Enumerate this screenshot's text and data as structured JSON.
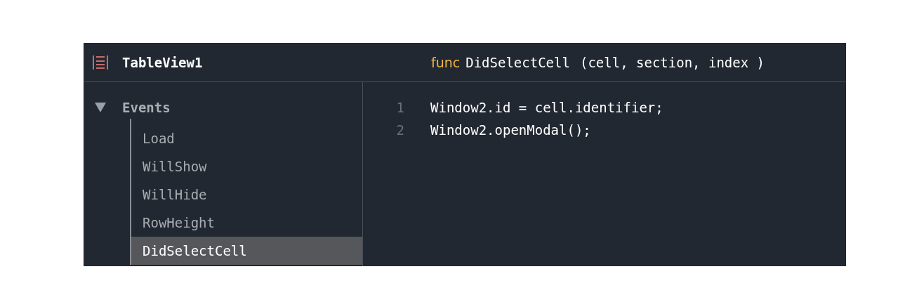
{
  "header": {
    "title": "TableView1",
    "signature": {
      "keyword": "func",
      "name": "DidSelectCell",
      "params": "(cell, section, index )"
    }
  },
  "sidebar": {
    "groups": [
      {
        "label": "Events",
        "expanded": true,
        "children": [
          {
            "label": "Load",
            "selected": false
          },
          {
            "label": "WillShow",
            "selected": false
          },
          {
            "label": "WillHide",
            "selected": false
          },
          {
            "label": "RowHeight",
            "selected": false
          },
          {
            "label": "DidSelectCell",
            "selected": true
          }
        ]
      }
    ]
  },
  "editor": {
    "lines": [
      {
        "number": "1",
        "code": "Window2.id = cell.identifier;"
      },
      {
        "number": "2",
        "code": "Window2.openModal();"
      }
    ]
  }
}
